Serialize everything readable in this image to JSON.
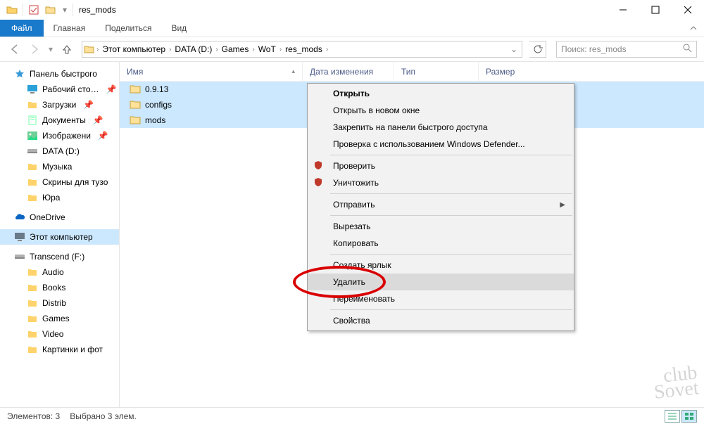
{
  "title": "res_mods",
  "ribbon": {
    "file": "Файл",
    "tabs": [
      "Главная",
      "Поделиться",
      "Вид"
    ]
  },
  "breadcrumbs": [
    "Этот компьютер",
    "DATA (D:)",
    "Games",
    "WoT",
    "res_mods"
  ],
  "search_placeholder": "Поиск: res_mods",
  "columns": {
    "name": "Имя",
    "date": "Дата изменения",
    "type": "Тип",
    "size": "Размер"
  },
  "tree": {
    "quick": "Панель быстрого",
    "quick_items": [
      "Рабочий сто…",
      "Загрузки",
      "Документы",
      "Изображени",
      "DATA (D:)",
      "Музыка",
      "Скрины для тузо",
      "Юра"
    ],
    "onedrive": "OneDrive",
    "thispc": "Этот компьютер",
    "transcend": "Transcend (F:)",
    "transcend_items": [
      "Audio",
      "Books",
      "Distrib",
      "Games",
      "Video",
      "Картинки и фот"
    ]
  },
  "files": [
    "0.9.13",
    "configs",
    "mods"
  ],
  "context": {
    "open": "Открыть",
    "new_window": "Открыть в новом окне",
    "pin": "Закрепить на панели быстрого доступа",
    "defender": "Проверка с использованием Windows Defender...",
    "check": "Проверить",
    "destroy": "Уничтожить",
    "send": "Отправить",
    "cut": "Вырезать",
    "copy": "Копировать",
    "shortcut": "Создать ярлык",
    "delete": "Удалить",
    "rename": "Переименовать",
    "props": "Свойства"
  },
  "status": {
    "count": "Элементов: 3",
    "selected": "Выбрано 3 элем."
  }
}
